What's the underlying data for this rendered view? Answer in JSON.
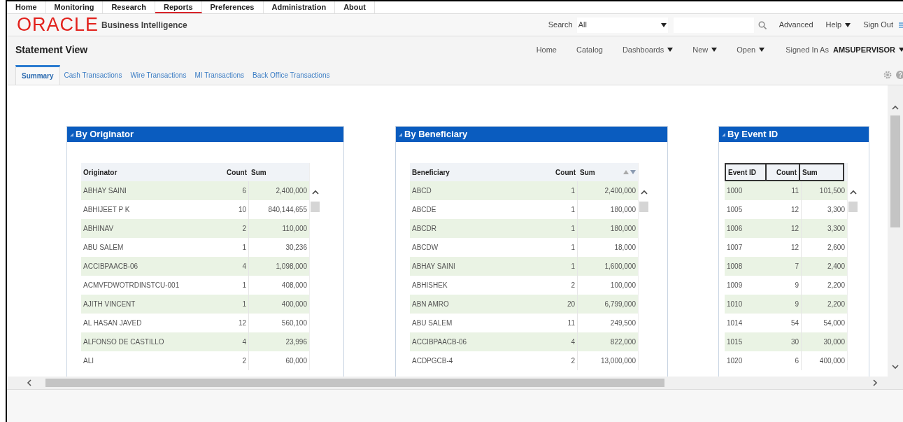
{
  "top_menu": [
    {
      "label": "Home",
      "selected": false
    },
    {
      "label": "Monitoring",
      "selected": false
    },
    {
      "label": "Research",
      "selected": false
    },
    {
      "label": "Reports",
      "selected": true
    },
    {
      "label": "Preferences",
      "selected": false
    },
    {
      "label": "Administration",
      "selected": false
    },
    {
      "label": "About",
      "selected": false
    }
  ],
  "header": {
    "logo": "ORACLE",
    "product": "Business Intelligence",
    "search_label": "Search",
    "search_scope": "All",
    "links": [
      {
        "label": "Advanced",
        "menu": false
      },
      {
        "label": "Help",
        "menu": true
      },
      {
        "label": "Sign Out",
        "menu": false
      }
    ]
  },
  "page_title": "Statement View",
  "nav": [
    {
      "label": "Home",
      "menu": false
    },
    {
      "label": "Catalog",
      "menu": false
    },
    {
      "label": "Dashboards",
      "menu": true
    },
    {
      "label": "New",
      "menu": true
    },
    {
      "label": "Open",
      "menu": true
    }
  ],
  "signed_in": {
    "label": "Signed In As",
    "user": "AMSUPERVISOR"
  },
  "tabs": [
    {
      "label": "Summary",
      "selected": true
    },
    {
      "label": "Cash Transactions",
      "selected": false
    },
    {
      "label": "Wire Transactions",
      "selected": false
    },
    {
      "label": "MI Transactions",
      "selected": false
    },
    {
      "label": "Back Office Transactions",
      "selected": false
    }
  ],
  "panels": [
    {
      "title": "By Originator",
      "header_outlined": false,
      "columns": [
        {
          "label": "Originator",
          "sort_arrows": false
        },
        {
          "label": "Count",
          "sort_arrows": false
        },
        {
          "label": "Sum",
          "sort_arrows": false
        }
      ],
      "rows": [
        [
          "ABHAY SAINI",
          "6",
          "2,400,000"
        ],
        [
          "ABHIJEET P K",
          "10",
          "840,144,655"
        ],
        [
          "ABHINAV",
          "2",
          "110,000"
        ],
        [
          "ABU SALEM",
          "1",
          "30,236"
        ],
        [
          "ACCIBPAACB-06",
          "4",
          "1,098,000"
        ],
        [
          "ACMVFDWOTRDINSTCU-001",
          "1",
          "408,000"
        ],
        [
          "AJITH VINCENT",
          "1",
          "400,000"
        ],
        [
          "AL HASAN JAVED",
          "12",
          "560,100"
        ],
        [
          "ALFONSO DE CASTILLO",
          "4",
          "23,996"
        ],
        [
          "ALI",
          "2",
          "60,000"
        ]
      ]
    },
    {
      "title": "By Beneficiary",
      "header_outlined": false,
      "columns": [
        {
          "label": "Beneficiary",
          "sort_arrows": false
        },
        {
          "label": "Count",
          "sort_arrows": false
        },
        {
          "label": "Sum",
          "sort_arrows": true
        }
      ],
      "rows": [
        [
          "ABCD",
          "1",
          "2,400,000"
        ],
        [
          "ABCDE",
          "1",
          "180,000"
        ],
        [
          "ABCDR",
          "1",
          "180,000"
        ],
        [
          "ABCDW",
          "1",
          "18,000"
        ],
        [
          "ABHAY SAINI",
          "1",
          "1,600,000"
        ],
        [
          "ABHISHEK",
          "2",
          "100,000"
        ],
        [
          "ABN AMRO",
          "20",
          "6,799,000"
        ],
        [
          "ABU SALEM",
          "11",
          "249,500"
        ],
        [
          "ACCIBPAACB-06",
          "4",
          "822,000"
        ],
        [
          "ACDPGCB-4",
          "2",
          "13,000,000"
        ]
      ]
    },
    {
      "title": "By Event ID",
      "header_outlined": true,
      "columns": [
        {
          "label": "Event ID",
          "sort_arrows": false
        },
        {
          "label": "Count",
          "sort_arrows": false
        },
        {
          "label": "Sum",
          "sort_arrows": false
        }
      ],
      "rows": [
        [
          "1000",
          "11",
          "101,500"
        ],
        [
          "1005",
          "12",
          "3,300"
        ],
        [
          "1006",
          "12",
          "3,300"
        ],
        [
          "1007",
          "12",
          "2,600"
        ],
        [
          "1008",
          "7",
          "2,400"
        ],
        [
          "1009",
          "9",
          "2,200"
        ],
        [
          "1010",
          "9",
          "2,200"
        ],
        [
          "1014",
          "54",
          "54,000"
        ],
        [
          "1015",
          "30",
          "30,000"
        ],
        [
          "1020",
          "6",
          "400,000"
        ]
      ]
    }
  ]
}
